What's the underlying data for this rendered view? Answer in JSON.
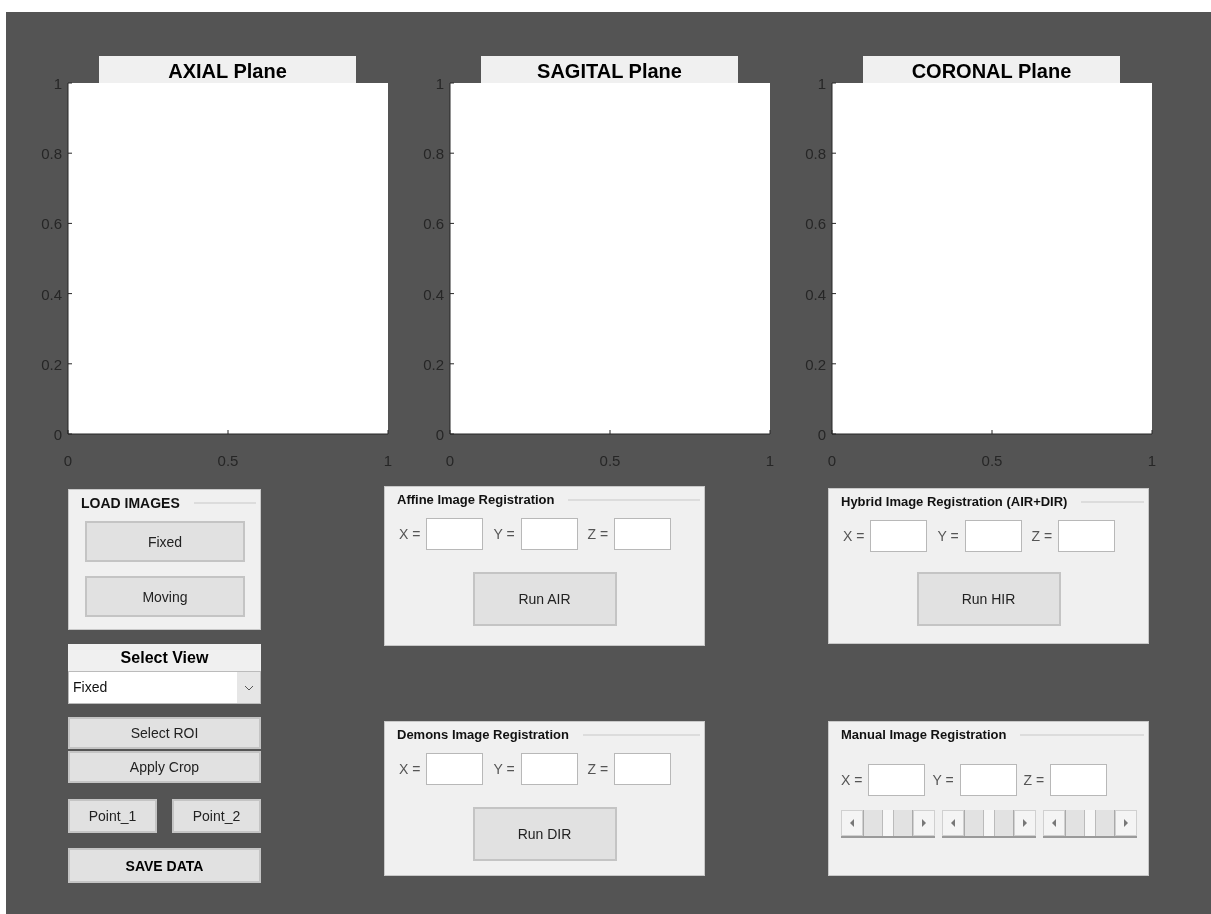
{
  "plots": [
    {
      "title": "AXIAL Plane",
      "chart_data": {
        "type": "line",
        "xlim": [
          0,
          1
        ],
        "ylim": [
          0,
          1
        ],
        "xticks": [
          0,
          0.5,
          1
        ],
        "yticks": [
          0,
          0.2,
          0.4,
          0.6,
          0.8,
          1
        ]
      }
    },
    {
      "title": "SAGITAL Plane",
      "chart_data": {
        "type": "line",
        "xlim": [
          0,
          1
        ],
        "ylim": [
          0,
          1
        ],
        "xticks": [
          0,
          0.5,
          1
        ],
        "yticks": [
          0,
          0.2,
          0.4,
          0.6,
          0.8,
          1
        ]
      }
    },
    {
      "title": "CORONAL Plane",
      "chart_data": {
        "type": "line",
        "xlim": [
          0,
          1
        ],
        "ylim": [
          0,
          1
        ],
        "xticks": [
          0,
          0.5,
          1
        ],
        "yticks": [
          0,
          0.2,
          0.4,
          0.6,
          0.8,
          1
        ]
      }
    }
  ],
  "load_images": {
    "title": "LOAD IMAGES",
    "buttons": [
      "Fixed",
      "Moving"
    ]
  },
  "select_view": {
    "label": "Select View",
    "value": "Fixed"
  },
  "roi_buttons": [
    "Select ROI",
    "Apply Crop"
  ],
  "point_buttons": [
    "Point_1",
    "Point_2"
  ],
  "save_button": "SAVE DATA",
  "middle_panels": [
    {
      "kind": "run",
      "title": "Affine Image Registration",
      "fields": [
        {
          "label": "X ="
        },
        {
          "label": "Y ="
        },
        {
          "label": "Z ="
        }
      ],
      "button": "Run AIR"
    },
    {
      "kind": "run",
      "title": "Demons Image Registration",
      "fields": [
        {
          "label": "X ="
        },
        {
          "label": "Y ="
        },
        {
          "label": "Z ="
        }
      ],
      "button": "Run DIR"
    }
  ],
  "right_panels": [
    {
      "kind": "run",
      "title": "Hybrid Image Registration (AIR+DIR)",
      "fields": [
        {
          "label": "X ="
        },
        {
          "label": "Y ="
        },
        {
          "label": "Z ="
        }
      ],
      "button": "Run HIR"
    },
    {
      "kind": "sliders",
      "title": "Manual Image Registration",
      "fields": [
        {
          "label": "X ="
        },
        {
          "label": "Y ="
        },
        {
          "label": "Z ="
        }
      ],
      "sliders": [
        {
          "level": 0.5
        },
        {
          "level": 0.5
        },
        {
          "level": 0.5
        }
      ]
    }
  ]
}
